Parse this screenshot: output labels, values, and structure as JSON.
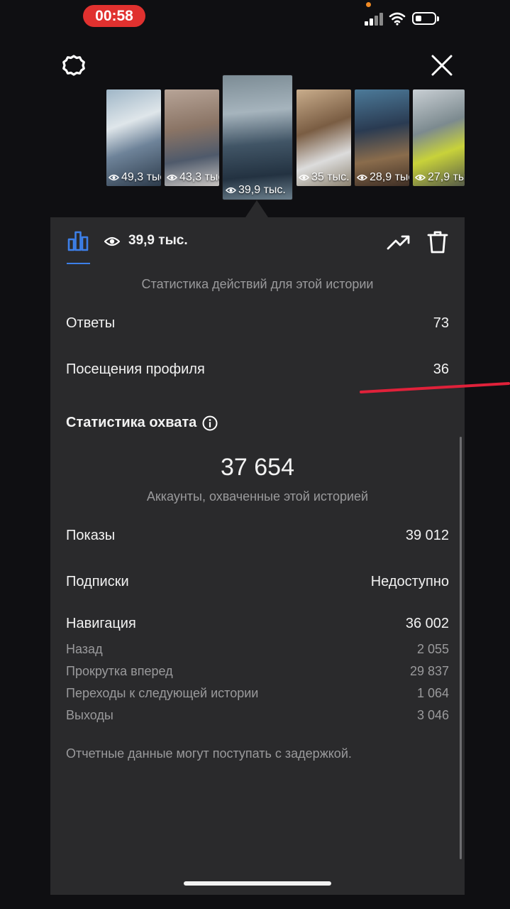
{
  "status_bar": {
    "time": "00:58"
  },
  "thumbnails": [
    {
      "views": "49,3 тыс."
    },
    {
      "views": "43,3 тыс."
    },
    {
      "views": "39,9 тыс."
    },
    {
      "views": "35 тыс."
    },
    {
      "views": "28,9 тыс."
    },
    {
      "views": "27,9 тыс."
    }
  ],
  "panel": {
    "header_views": "39,9 тыс.",
    "actions_caption": "Статистика действий для этой истории",
    "rows": {
      "replies_label": "Ответы",
      "replies_value": "73",
      "profile_visits_label": "Посещения профиля",
      "profile_visits_value": "36"
    },
    "reach": {
      "title": "Статистика охвата",
      "accounts_reached": "37 654",
      "accounts_caption": "Аккаунты, охваченные этой историей",
      "impressions_label": "Показы",
      "impressions_value": "39 012",
      "follows_label": "Подписки",
      "follows_value": "Недоступно",
      "navigation_label": "Навигация",
      "navigation_value": "36 002",
      "back_label": "Назад",
      "back_value": "2 055",
      "forward_label": "Прокрутка вперед",
      "forward_value": "29 837",
      "next_story_label": "Переходы к следующей истории",
      "next_story_value": "1 064",
      "exits_label": "Выходы",
      "exits_value": "3 046",
      "footnote": "Отчетные данные могут поступать с задержкой."
    }
  },
  "colors": {
    "accent": "#3d7fe8",
    "panel": "#2a2a2c",
    "annotation_red": "#e0213a",
    "recording": "#e0312f"
  }
}
